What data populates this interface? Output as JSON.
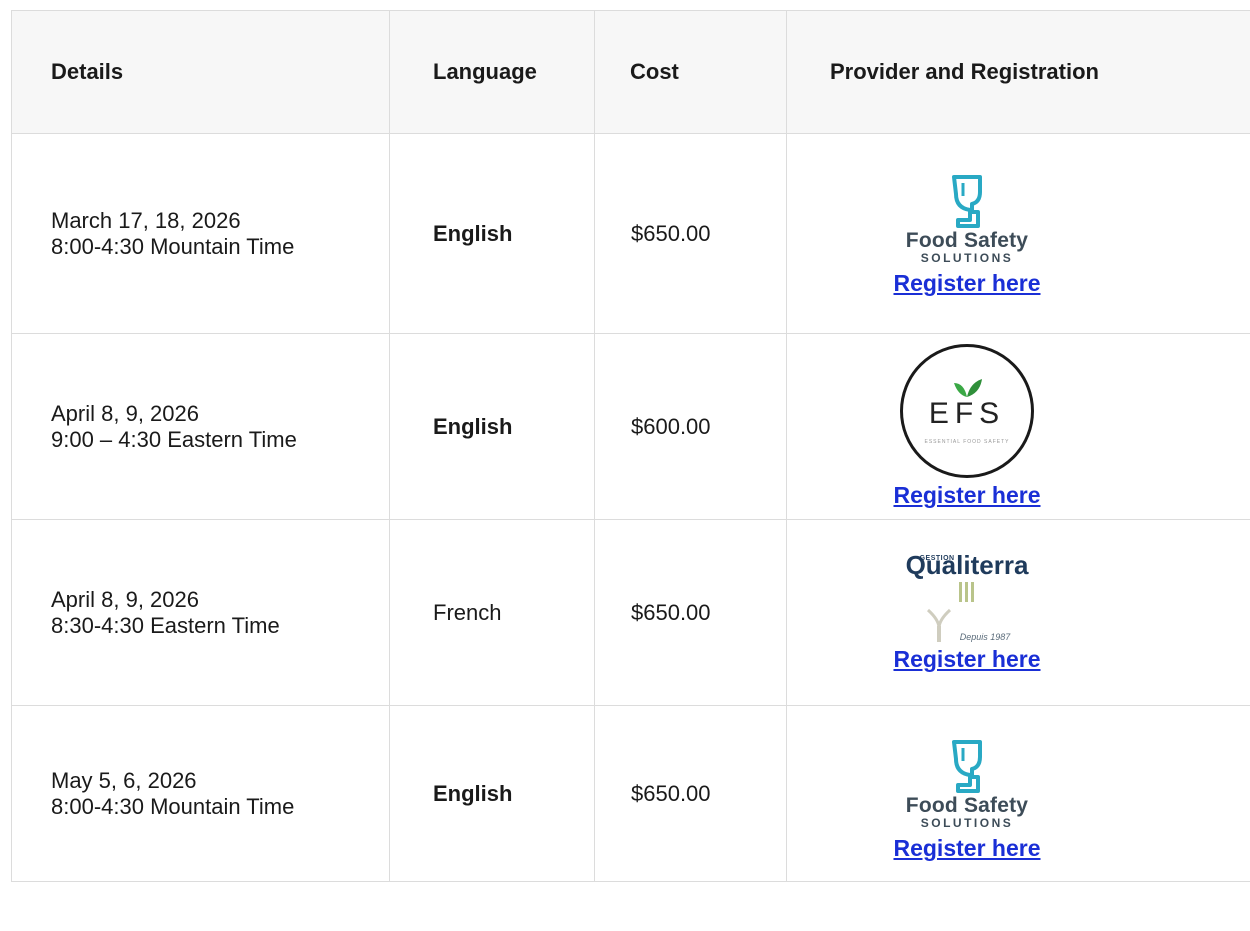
{
  "header": {
    "details": "Details",
    "language": "Language",
    "cost": "Cost",
    "provider": "Provider and Registration"
  },
  "rows": [
    {
      "date": "March 17, 18, 2026",
      "time": "8:00-4:30 Mountain Time",
      "language": "English",
      "cost": "$650.00",
      "provider_logo": {
        "line1": "Food Safety",
        "line2": "SOLUTIONS"
      },
      "register": "Register here"
    },
    {
      "date": "April 8, 9, 2026",
      "time": "9:00 – 4:30 Eastern Time",
      "language": "English",
      "cost": "$600.00",
      "provider_logo": {
        "letters": "EFS",
        "tagline": "ESSENTIAL FOOD SAFETY"
      },
      "register": "Register here"
    },
    {
      "date": "April 8, 9, 2026",
      "time": "8:30-4:30 Eastern Time",
      "language": "French",
      "cost": "$650.00",
      "provider_logo": {
        "word": "Qualiterra",
        "small": "GESTION",
        "since": "Depuis 1987"
      },
      "register": "Register here"
    },
    {
      "date": "May 5, 6, 2026",
      "time": "8:00-4:30 Mountain Time",
      "language": "English",
      "cost": "$650.00",
      "provider_logo": {
        "line1": "Food Safety",
        "line2": "SOLUTIONS"
      },
      "register": "Register here"
    }
  ],
  "colors": {
    "link": "#1a2fd6",
    "header_bg": "#f7f7f7",
    "border": "#dcdcdc",
    "fss_teal": "#29a9c4",
    "qualiterra_blue": "#1f3b5c"
  }
}
